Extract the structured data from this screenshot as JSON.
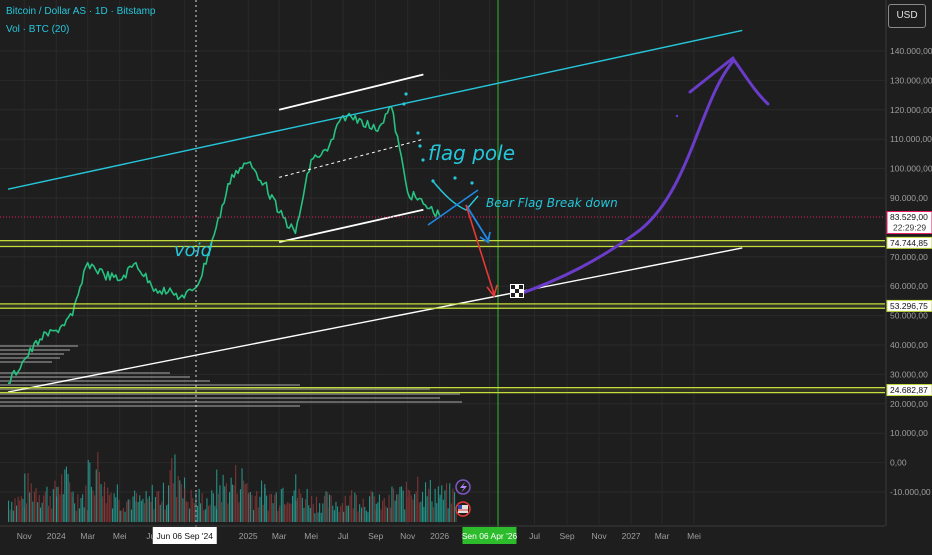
{
  "header": {
    "symbol_title": "Bitcoin / Dollar AS · 1D · Bitstamp",
    "volume_title": "Vol · BTC (20)",
    "currency": "USD"
  },
  "colors": {
    "background": "#1e1e1e",
    "price_up": "#26c281",
    "title_text": "#26c6da",
    "channel_line": "#26c6da",
    "support_line": "#ffffff",
    "highlight_zone": "#c6dc3c",
    "current_price_line": "#e91e63",
    "projection_arrow": "#6a3cc9",
    "breakdown_arrow": "#e53935",
    "flag_arrow": "#1e88e5",
    "cursor_label": "#2cbc2c"
  },
  "chart_data": {
    "type": "line",
    "title": "Bitcoin / Dollar AS · 1D · Bitstamp",
    "xlabel": "",
    "ylabel": "",
    "ylim": [
      -15000,
      148000
    ],
    "volume_ylim": [
      -15000,
      15000
    ],
    "price_axis_ticks": [
      "140.000,00",
      "130.000,00",
      "120.000,00",
      "110.000,00",
      "100.000,00",
      "90.000,00",
      "70.000,00",
      "60.000,00",
      "50.000,00",
      "40.000,00",
      "30.000,00",
      "20.000,00",
      "10.000,00",
      "0,00",
      "-10.000,00"
    ],
    "price_axis_values": [
      140000,
      130000,
      120000,
      110000,
      100000,
      90000,
      70000,
      60000,
      50000,
      40000,
      30000,
      20000,
      10000,
      0,
      -10000
    ],
    "time_axis_ticks": [
      "Nov",
      "2024",
      "Mar",
      "Mei",
      "Jul",
      "Jun 06 Sep '24",
      "2025",
      "Mar",
      "Mei",
      "Jul",
      "Sep",
      "Nov",
      "2026",
      "Sen 06 Apr '26",
      "Jul",
      "Sep",
      "Nov",
      "2027",
      "Mar",
      "Mei"
    ],
    "time_axis_dates": [
      "2023-11-01",
      "2024-01-01",
      "2024-03-01",
      "2024-05-01",
      "2024-07-01",
      "2024-09-02",
      "2025-01-01",
      "2025-03-01",
      "2025-05-01",
      "2025-07-01",
      "2025-09-01",
      "2025-11-01",
      "2026-01-01",
      "2026-04-06",
      "2026-07-01",
      "2026-09-01",
      "2026-11-01",
      "2027-01-01",
      "2027-03-01",
      "2027-05-01"
    ],
    "price_labels": [
      {
        "text": "83.529,00",
        "value": 83529,
        "sub": "22:29:29",
        "kind": "current"
      },
      {
        "text": "74.744,85",
        "value": 74745,
        "kind": "level"
      },
      {
        "text": "53.296,75",
        "value": 53297,
        "kind": "level"
      },
      {
        "text": "24.682,87",
        "value": 24683,
        "kind": "level"
      }
    ],
    "series": [
      {
        "name": "Bitcoin / Dollar AS",
        "x": [
          "2023-10-01",
          "2023-11-01",
          "2023-12-01",
          "2024-01-01",
          "2024-02-01",
          "2024-03-01",
          "2024-04-01",
          "2024-05-01",
          "2024-06-01",
          "2024-07-01",
          "2024-08-01",
          "2024-09-01",
          "2024-10-01",
          "2024-11-01",
          "2024-12-01",
          "2025-01-01",
          "2025-02-01",
          "2025-03-01",
          "2025-04-01",
          "2025-05-01",
          "2025-06-01",
          "2025-07-01",
          "2025-08-01",
          "2025-09-01",
          "2025-10-01",
          "2025-11-01",
          "2025-12-01",
          "2026-01-01"
        ],
        "y": [
          27000,
          35000,
          42000,
          45000,
          50000,
          68000,
          64000,
          62000,
          68000,
          60000,
          58000,
          56000,
          62000,
          80000,
          98000,
          102000,
          95000,
          85000,
          78000,
          103000,
          106000,
          118000,
          117000,
          113000,
          121000,
          92000,
          88000,
          84000
        ]
      }
    ],
    "volume": {
      "x": [
        "2023-10-01",
        "2023-11-01",
        "2023-12-01",
        "2024-01-01",
        "2024-02-01",
        "2024-03-01",
        "2024-04-01",
        "2024-05-01",
        "2024-06-01",
        "2024-07-01",
        "2024-08-01",
        "2024-09-01",
        "2024-10-01",
        "2024-11-01",
        "2024-12-01",
        "2025-01-01",
        "2025-02-01",
        "2025-03-01",
        "2025-04-01",
        "2025-05-01",
        "2025-06-01",
        "2025-07-01",
        "2025-08-01",
        "2025-09-01",
        "2025-10-01",
        "2025-11-01",
        "2025-12-01",
        "2026-01-01"
      ],
      "values": [
        3000,
        4500,
        3800,
        5200,
        3500,
        7000,
        4200,
        3000,
        2800,
        3600,
        6500,
        3200,
        3000,
        4800,
        5500,
        3800,
        3400,
        4600,
        3500,
        2800,
        2600,
        3200,
        2900,
        2500,
        3600,
        5200,
        4000,
        3500
      ]
    },
    "drawings": [
      {
        "type": "trend_line",
        "x": [
          "2023-10-01",
          "2027-08-01"
        ],
        "y": [
          93000,
          147000
        ]
      },
      {
        "type": "trend_line",
        "x": [
          "2023-10-01",
          "2027-08-01"
        ],
        "y": [
          24000,
          73000
        ]
      },
      {
        "type": "trend_line",
        "x": [
          "2025-03-01",
          "2025-12-01"
        ],
        "y": [
          120000,
          132000
        ]
      },
      {
        "type": "trend_line",
        "x": [
          "2025-03-01",
          "2025-12-01"
        ],
        "y": [
          75000,
          86000
        ]
      },
      {
        "type": "dashed_line",
        "x": [
          "2025-03-01",
          "2025-12-01"
        ],
        "y": [
          97000,
          110000
        ]
      },
      {
        "type": "horizontal_zone",
        "y": [
          73500,
          75500
        ]
      },
      {
        "type": "horizontal_zone",
        "y": [
          52500,
          54000
        ]
      },
      {
        "type": "horizontal_zone",
        "y": [
          23800,
          25500
        ]
      },
      {
        "type": "horizontal_line",
        "y": 83529
      }
    ],
    "annotations": [
      {
        "text": "void",
        "x": "2024-04-15",
        "y": 70000
      },
      {
        "text": "flag pole",
        "x": "2025-11-15",
        "y": 101000
      },
      {
        "text": "Bear Flag Break down",
        "x": "2025-12-20",
        "y": 87500
      }
    ],
    "grid": true,
    "legend": "none"
  }
}
